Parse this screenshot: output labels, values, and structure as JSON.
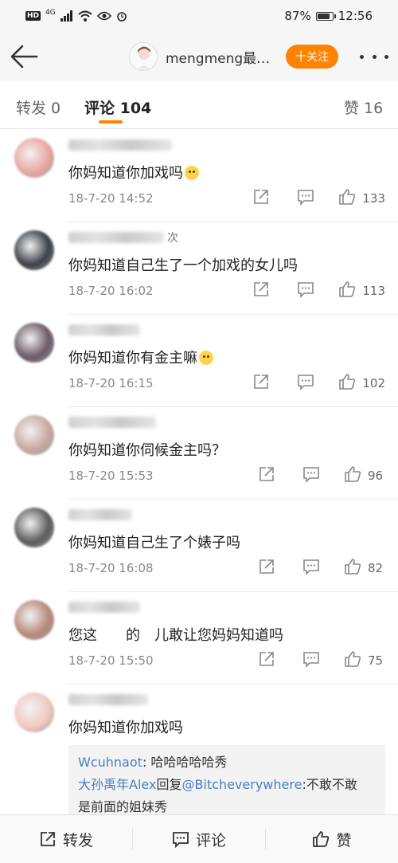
{
  "status_bar": {
    "network": "4G",
    "battery": "87%",
    "battery_level": 0.87,
    "time": "12:56"
  },
  "nav": {
    "username": "mengmeng最…",
    "follow_label": "十关注"
  },
  "tabs": [
    {
      "label": "转发 0"
    },
    {
      "label": "评论 104"
    },
    {
      "label": "赞 16"
    }
  ],
  "comments": [
    {
      "suffix": "",
      "text": "你妈知道你加戏吗",
      "emoji": true,
      "time": "18-7-20 14:52",
      "likes": "133",
      "avatar_color": "#e8a7a2"
    },
    {
      "suffix": "次",
      "text": "你妈知道自己生了一个加戏的女儿吗",
      "emoji": false,
      "time": "18-7-20 16:02",
      "likes": "113",
      "avatar_color": "#3a4048"
    },
    {
      "suffix": "",
      "text": "你妈知道你有金主嘛",
      "emoji": true,
      "time": "18-7-20 16:15",
      "likes": "102",
      "avatar_color": "#6b5a66"
    },
    {
      "suffix": "",
      "text": "你妈知道你伺候金主吗？",
      "emoji": false,
      "time": "18-7-20 15:53",
      "likes": "96",
      "avatar_color": "#c9a8a0"
    },
    {
      "suffix": "",
      "text": "你妈知道自己生了个婊子吗",
      "emoji": false,
      "time": "18-7-20 16:08",
      "likes": "82",
      "avatar_color": "#5c5c5c"
    },
    {
      "suffix": "",
      "text": "您这　　的　儿敢让您妈妈知道吗",
      "emoji": false,
      "time": "18-7-20 15:50",
      "likes": "75",
      "avatar_color": "#b88a7a"
    },
    {
      "suffix": "",
      "text": "你妈知道你加戏吗",
      "emoji": false,
      "time": "",
      "likes": "",
      "avatar_color": "#f2c9c0"
    }
  ],
  "reply_box": {
    "line1_user": "Wcuhnaot",
    "line1_text": ": 哈哈哈哈哈秀",
    "line2_user": "大孙禹年Alex",
    "line2_mid": "回复",
    "line2_mention": "@Bitcheverywhere",
    "line2_text": ":不敢不敢",
    "line3_text": "是前面的姐妹秀"
  },
  "bottom_bar": {
    "repost": "转发",
    "comment": "评论",
    "like": "赞"
  },
  "colors": {
    "accent": "#ff8200",
    "link": "#4a7cc7"
  }
}
